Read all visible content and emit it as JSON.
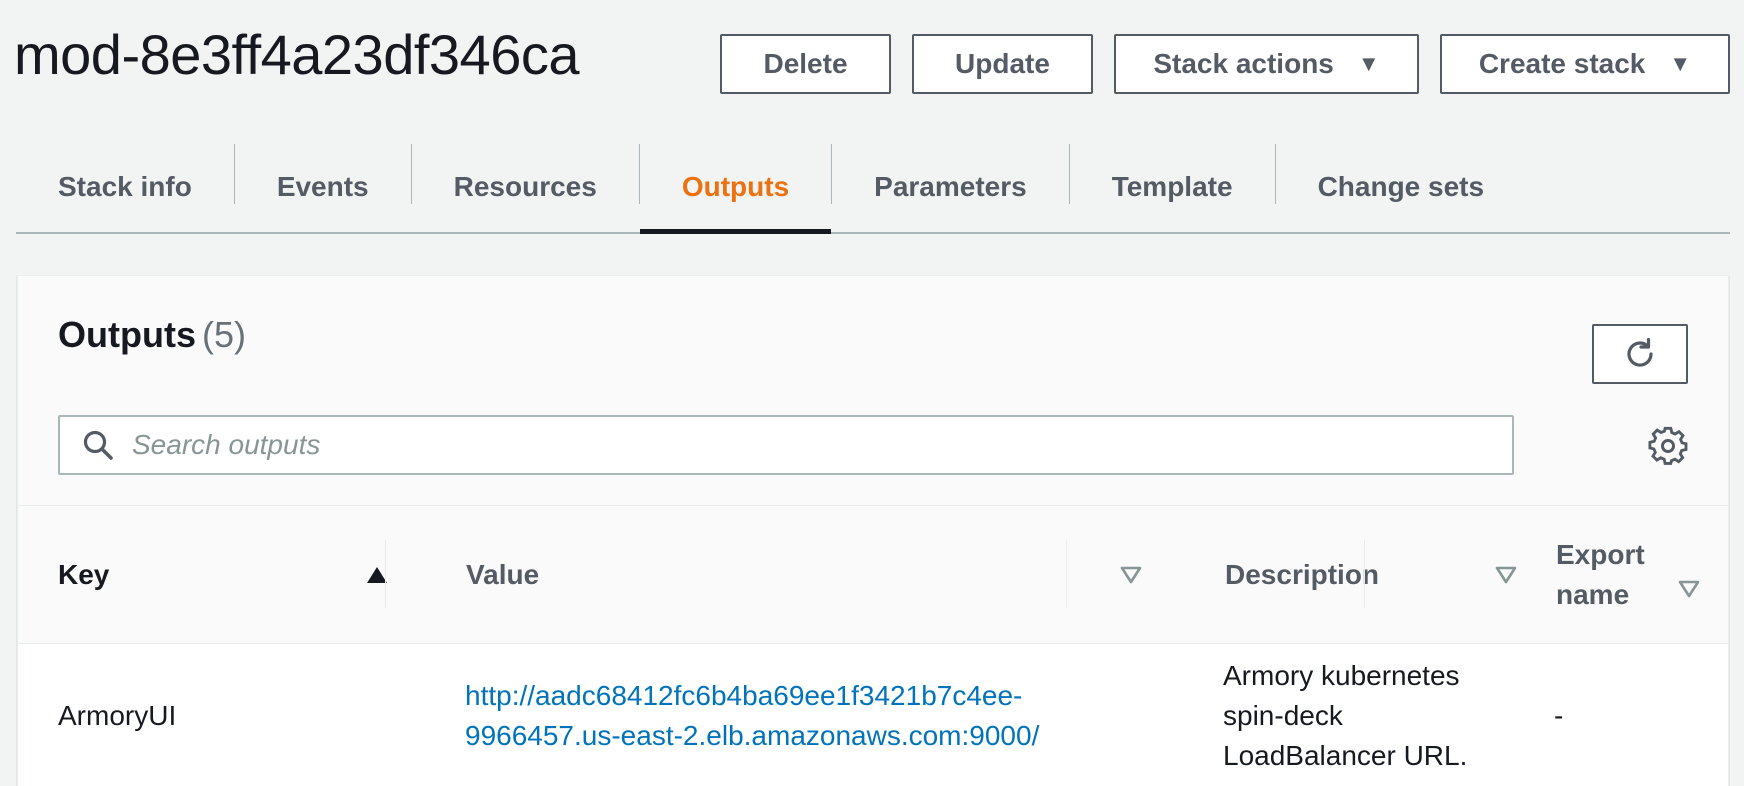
{
  "header": {
    "title": "mod-8e3ff4a23df346ca",
    "buttons": {
      "delete": "Delete",
      "update": "Update",
      "stack_actions": "Stack actions",
      "create_stack": "Create stack"
    }
  },
  "tabs": [
    {
      "label": "Stack info"
    },
    {
      "label": "Events"
    },
    {
      "label": "Resources"
    },
    {
      "label": "Outputs",
      "active": true
    },
    {
      "label": "Parameters"
    },
    {
      "label": "Template"
    },
    {
      "label": "Change sets"
    }
  ],
  "outputs": {
    "title": "Outputs",
    "count": "(5)",
    "search_placeholder": "Search outputs",
    "columns": {
      "key": "Key",
      "value": "Value",
      "description": "Description",
      "export_name_1": "Export",
      "export_name_2": "name"
    },
    "rows": [
      {
        "key": "ArmoryUI",
        "value_line1": "http://aadc68412fc6b4ba69ee1f3421b7c4ee-",
        "value_line2": "9966457.us-east-2.elb.amazonaws.com:9000/",
        "description_line1": "Armory kubernetes",
        "description_line2": "spin-deck",
        "description_line3": "LoadBalancer URL.",
        "export_name": "-"
      }
    ]
  },
  "colors": {
    "accent_active_tab": "#ec7211",
    "link": "#0073bb",
    "text": "#16191f",
    "muted": "#545b64"
  },
  "icons": [
    "caret-down-icon",
    "refresh-icon",
    "search-icon",
    "gear-icon",
    "sort-ascending-icon",
    "sort-descending-icon"
  ]
}
